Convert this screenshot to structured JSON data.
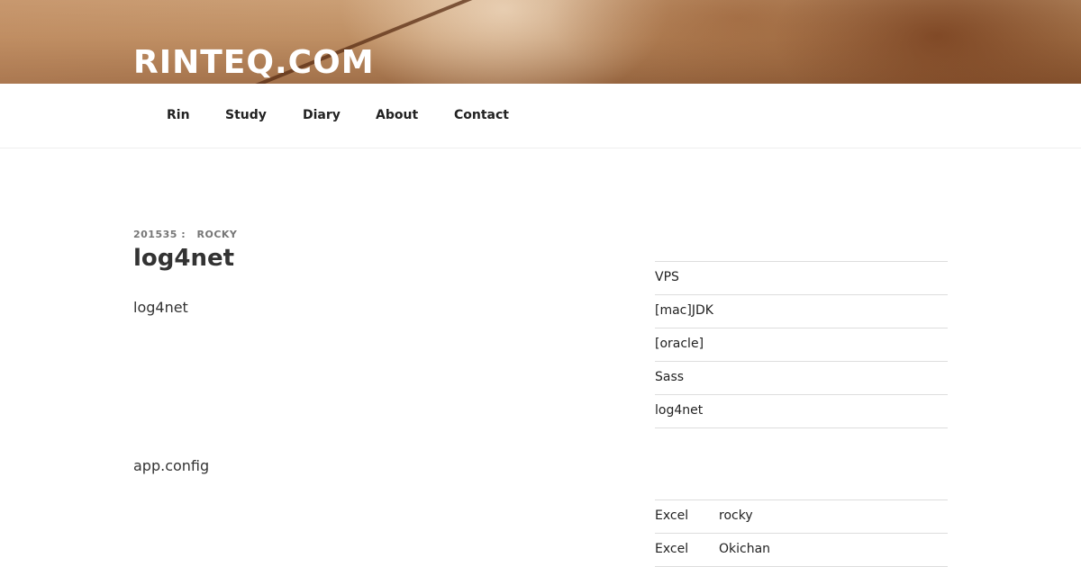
{
  "site": {
    "title": "RINTEQ.COM"
  },
  "nav": {
    "items": [
      "Rin",
      "Study",
      "Diary",
      "About",
      "Contact"
    ]
  },
  "post": {
    "date": "201535 :",
    "author": "ROCKY",
    "title": "log4net",
    "paragraphs": [
      "log4net",
      "app.config"
    ]
  },
  "sidebar": {
    "recent_posts": [
      "VPS",
      "[mac]JDK",
      "[oracle]",
      "Sass",
      "log4net"
    ],
    "recent_comments": [
      {
        "post": "Excel",
        "author": "rocky"
      },
      {
        "post": "Excel",
        "author": "Okichan"
      }
    ]
  }
}
